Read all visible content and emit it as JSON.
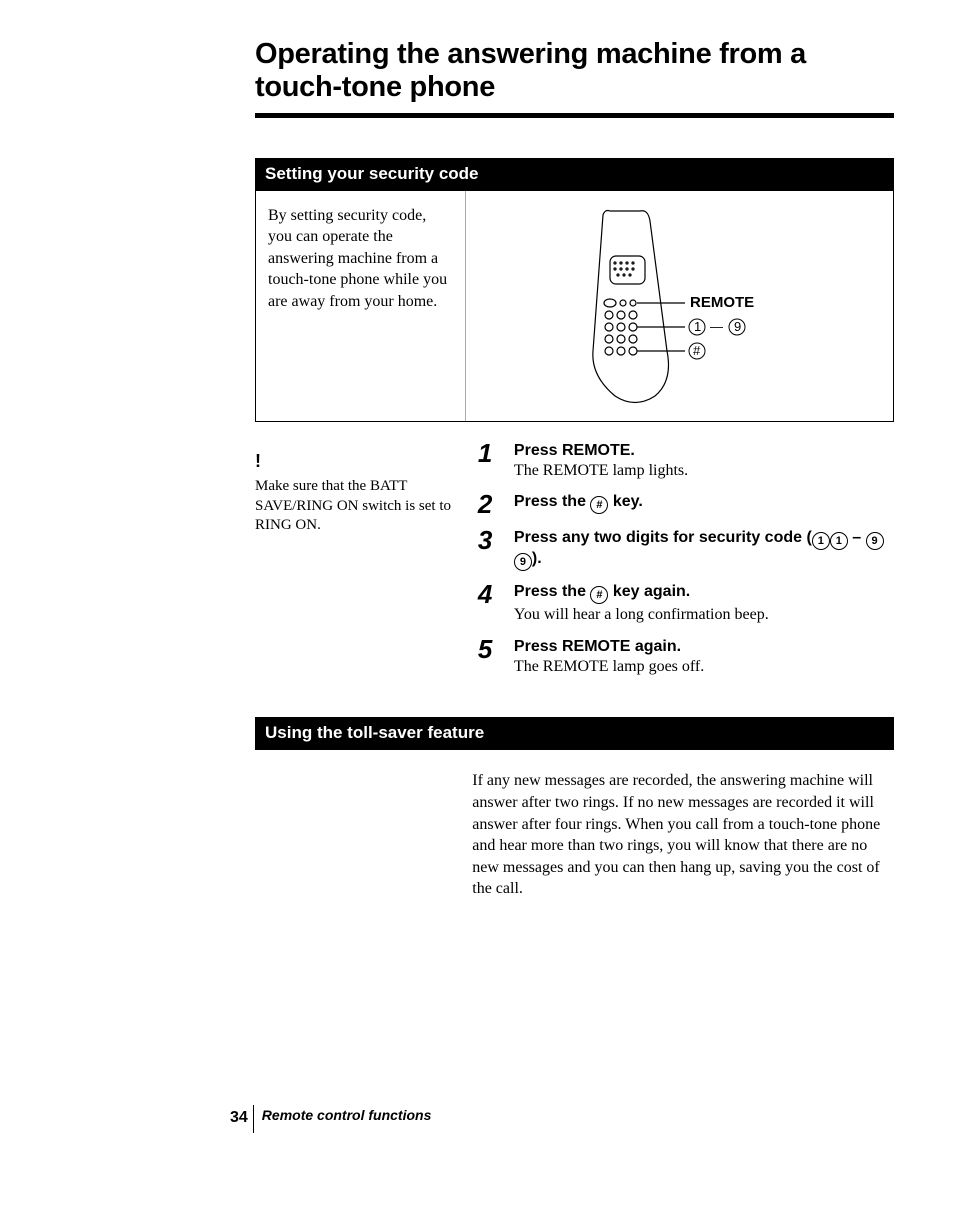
{
  "title": "Operating the answering machine from a touch-tone phone",
  "section1": {
    "heading": "Setting your security code",
    "intro": "By setting security code, you can operate the answering machine from a touch-tone phone while you are away from your home.",
    "diagram": {
      "label_remote": "REMOTE",
      "label_keys": "① — ⑨",
      "label_hash": "＃"
    },
    "warning_mark": "!",
    "warning_text": "Make sure that the BATT SAVE/RING ON switch is set to RING ON.",
    "steps": [
      {
        "num": "1",
        "head": "Press REMOTE.",
        "sub": "The REMOTE lamp lights."
      },
      {
        "num": "2",
        "head": "Press the ＃ key.",
        "sub": ""
      },
      {
        "num": "3",
        "head": "Press any two digits for security code (①① – ⑨⑨).",
        "sub": ""
      },
      {
        "num": "4",
        "head": "Press the ＃ key again.",
        "sub": "You will hear a long confirmation beep."
      },
      {
        "num": "5",
        "head": "Press REMOTE again.",
        "sub": "The REMOTE lamp goes off."
      }
    ]
  },
  "section2": {
    "heading": "Using the toll-saver feature",
    "body": "If any new messages are recorded, the answering machine will answer after two rings. If no new messages are recorded it will answer after four rings. When you call from a touch-tone phone and hear more than two rings, you will know that there are no new messages and you can then hang up, saving you the cost of the call."
  },
  "footer": {
    "page_num": "34",
    "section_label": "Remote control functions"
  }
}
